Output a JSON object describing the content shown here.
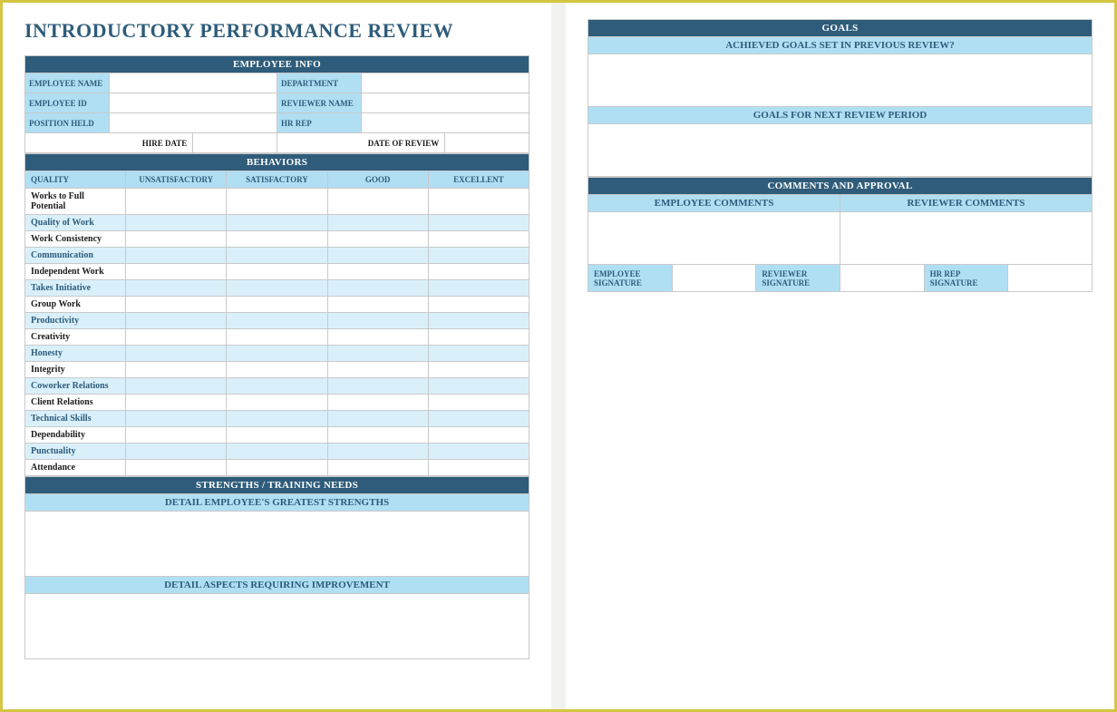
{
  "title": "INTRODUCTORY PERFORMANCE REVIEW",
  "sections": {
    "employee_info": "EMPLOYEE INFO",
    "behaviors": "BEHAVIORS",
    "strengths": "STRENGTHS / TRAINING NEEDS",
    "goals": "GOALS",
    "comments": "COMMENTS AND APPROVAL"
  },
  "emp_info": {
    "name": "EMPLOYEE NAME",
    "dept": "DEPARTMENT",
    "id": "EMPLOYEE ID",
    "reviewer": "REVIEWER NAME",
    "position": "POSITION HELD",
    "hrrep": "HR REP",
    "hire_date": "HIRE DATE",
    "review_date": "DATE OF REVIEW"
  },
  "behavior_cols": {
    "quality": "QUALITY",
    "unsat": "UNSATISFACTORY",
    "sat": "SATISFACTORY",
    "good": "GOOD",
    "exc": "EXCELLENT"
  },
  "behavior_rows": [
    "Works to Full Potential",
    "Quality of Work",
    "Work Consistency",
    "Communication",
    "Independent Work",
    "Takes Initiative",
    "Group Work",
    "Productivity",
    "Creativity",
    "Honesty",
    "Integrity",
    "Coworker Relations",
    "Client Relations",
    "Technical Skills",
    "Dependability",
    "Punctuality",
    "Attendance"
  ],
  "strengths": {
    "greatest": "DETAIL EMPLOYEE'S GREATEST STRENGTHS",
    "improve": "DETAIL ASPECTS REQUIRING IMPROVEMENT"
  },
  "goals": {
    "achieved": "ACHIEVED GOALS SET IN PREVIOUS REVIEW?",
    "next": "GOALS FOR NEXT REVIEW PERIOD"
  },
  "comments": {
    "emp": "EMPLOYEE COMMENTS",
    "rev": "REVIEWER COMMENTS"
  },
  "signatures": {
    "emp": "EMPLOYEE SIGNATURE",
    "rev": "REVIEWER SIGNATURE",
    "hr": "HR REP SIGNATURE"
  },
  "watermark": ""
}
